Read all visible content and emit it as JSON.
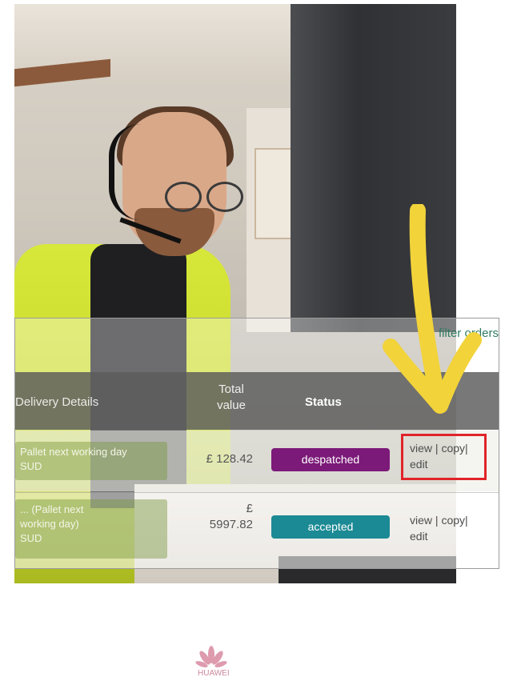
{
  "brand_logo": "HUAWEI",
  "filter_link": "filter orders",
  "table": {
    "headers": {
      "delivery": "Delivery Details",
      "total_line1": "Total",
      "total_line2": "value",
      "status": "Status"
    },
    "rows": [
      {
        "delivery_line1": "Pallet next working day",
        "delivery_line2": "SUD",
        "total": "£ 128.42",
        "status": "despatched",
        "status_color": "#7b1a78",
        "actions": {
          "view": "view",
          "sep1": " | ",
          "copy": "copy",
          "sep2": "|",
          "edit": "edit"
        }
      },
      {
        "delivery_line1": "... (Pallet next",
        "delivery_line2": "working day)",
        "delivery_line3": "SUD",
        "total_line1": "£",
        "total_line2": "5997.82",
        "status": "accepted",
        "status_color": "#1b8a94",
        "actions": {
          "view": "view",
          "sep1": " | ",
          "copy": "copy",
          "sep2": "|",
          "edit": "edit"
        }
      }
    ]
  },
  "annotation": {
    "arrow_color": "#f2d33a",
    "highlight_color": "#e0242a",
    "arrow_icon": "arrow-down-icon"
  }
}
